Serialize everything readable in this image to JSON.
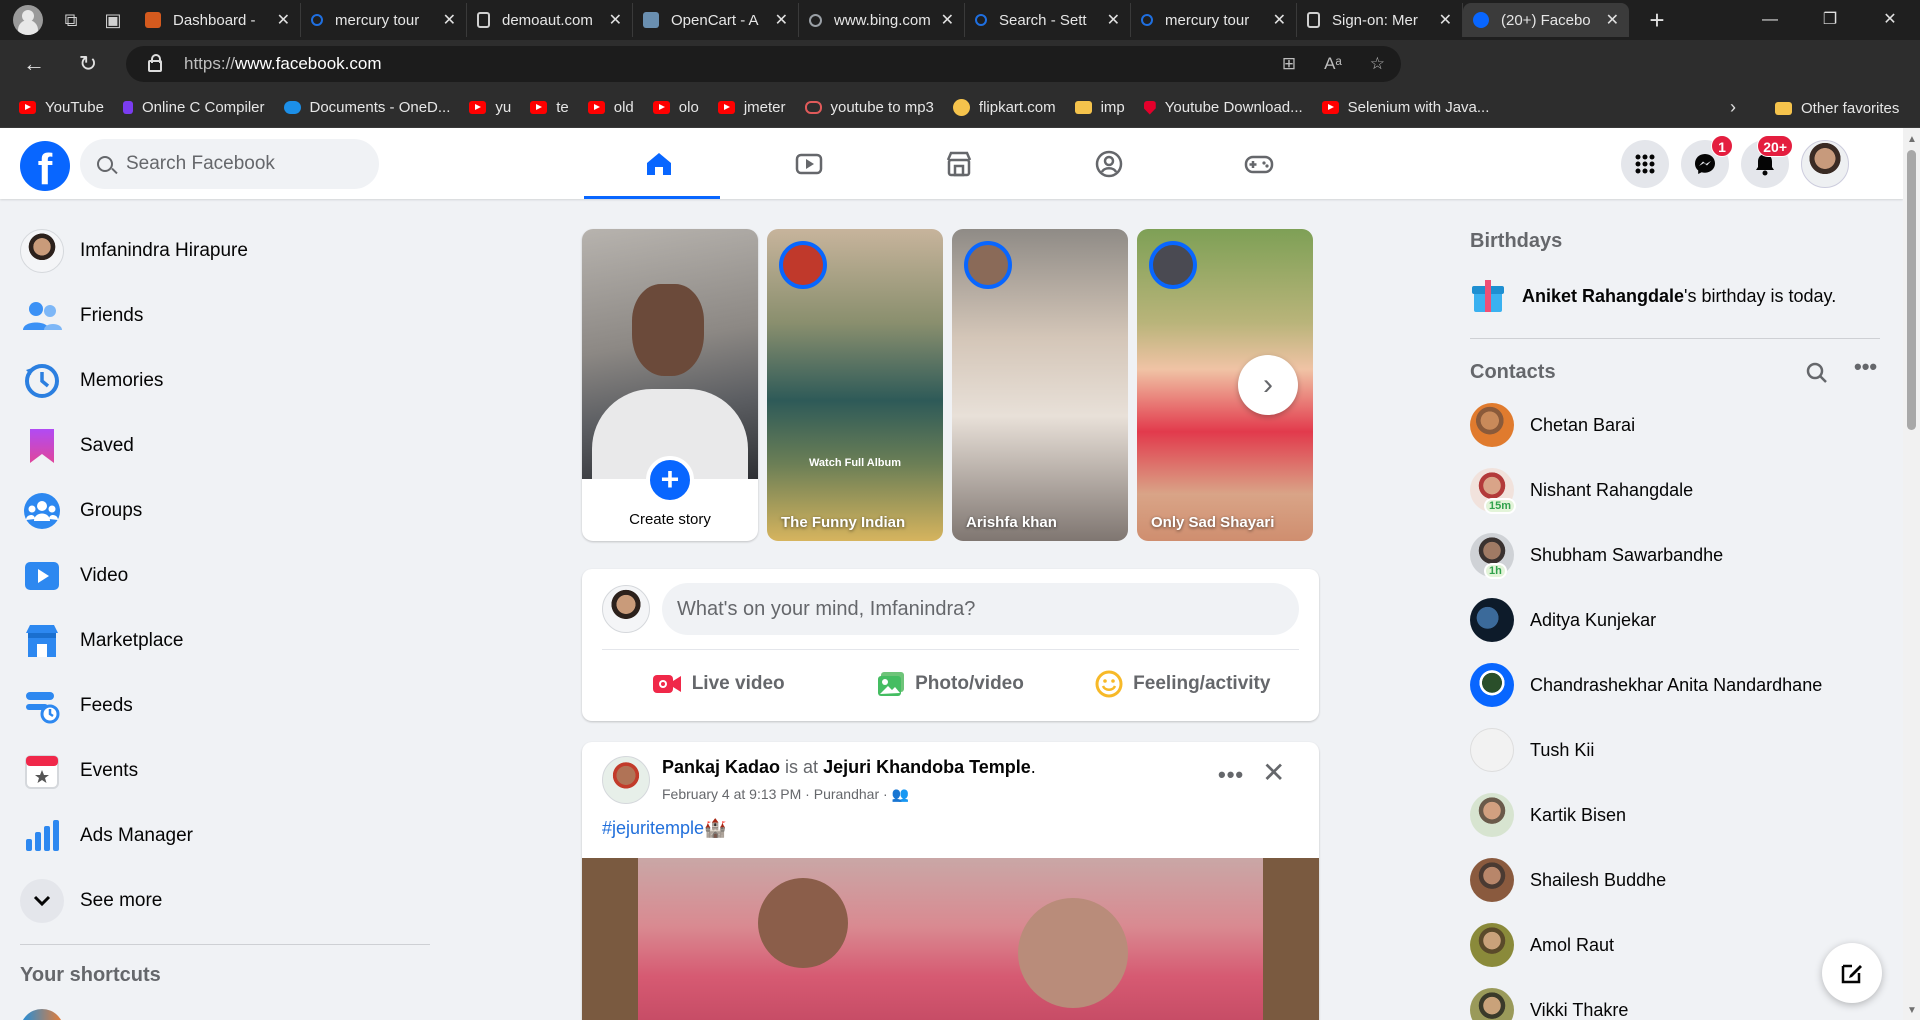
{
  "browser": {
    "tabs": [
      {
        "title": "Dashboard - ",
        "color": "#d45a1e"
      },
      {
        "title": "mercury tour",
        "color": "#1f6fe0"
      },
      {
        "title": "demoaut.com",
        "color": "#9aa0a6"
      },
      {
        "title": "OpenCart - A",
        "color": "#6a8fb0"
      },
      {
        "title": "www.bing.com",
        "color": "#9aa0a6"
      },
      {
        "title": "Search - Sett",
        "color": "#1f6fe0"
      },
      {
        "title": "mercury tour",
        "color": "#1f6fe0"
      },
      {
        "title": "Sign-on: Mer",
        "color": "#9aa0a6"
      },
      {
        "title": "(20+) Facebo",
        "color": "#0866ff"
      }
    ],
    "url_prefix": "https://",
    "url_host": "www.facebook.com",
    "bookmarks": [
      {
        "label": "YouTube",
        "icon": "youtube-icon"
      },
      {
        "label": "Online C Compiler",
        "icon": "compiler-icon"
      },
      {
        "label": "Documents - OneD...",
        "icon": "onedrive-icon"
      },
      {
        "label": "yu",
        "icon": "youtube-icon"
      },
      {
        "label": "te",
        "icon": "youtube-icon"
      },
      {
        "label": "old",
        "icon": "youtube-icon"
      },
      {
        "label": "olo",
        "icon": "youtube-icon"
      },
      {
        "label": "jmeter",
        "icon": "youtube-icon"
      },
      {
        "label": "youtube to mp3",
        "icon": "link-icon"
      },
      {
        "label": "flipkart.com",
        "icon": "flipkart-icon"
      },
      {
        "label": "imp",
        "icon": "folder-icon"
      },
      {
        "label": "Youtube Download...",
        "icon": "download-icon"
      },
      {
        "label": "Selenium with Java...",
        "icon": "youtube-icon"
      }
    ],
    "other_favorites": "Other favorites"
  },
  "fb": {
    "search_placeholder": "Search Facebook",
    "notifications_badge": "20+",
    "messenger_badge": "1",
    "left_nav": [
      {
        "label": "Imfanindra Hirapure",
        "icon": "profile-avatar"
      },
      {
        "label": "Friends",
        "icon": "friends-icon"
      },
      {
        "label": "Memories",
        "icon": "memories-icon"
      },
      {
        "label": "Saved",
        "icon": "saved-icon"
      },
      {
        "label": "Groups",
        "icon": "groups-icon"
      },
      {
        "label": "Video",
        "icon": "video-icon"
      },
      {
        "label": "Marketplace",
        "icon": "marketplace-icon"
      },
      {
        "label": "Feeds",
        "icon": "feeds-icon"
      },
      {
        "label": "Events",
        "icon": "events-icon"
      },
      {
        "label": "Ads Manager",
        "icon": "ads-manager-icon"
      },
      {
        "label": "See more",
        "icon": "chevron-down-icon"
      }
    ],
    "shortcuts_heading": "Your shortcuts",
    "stories": {
      "create_label": "Create story",
      "items": [
        {
          "name": "The Funny Indian",
          "overlay": "Watch Full Album"
        },
        {
          "name": "Arishfa khan",
          "overlay": ""
        },
        {
          "name": "Only Sad Shayari",
          "overlay": ""
        }
      ]
    },
    "composer": {
      "placeholder": "What's on your mind, Imfanindra?",
      "actions": [
        "Live video",
        "Photo/video",
        "Feeling/activity"
      ]
    },
    "post": {
      "author": "Pankaj Kadao",
      "is_at": " is at ",
      "place": "Jejuri Khandoba Temple",
      "period": ".",
      "meta": "February 4 at 9:13 PM · Purandhar · ",
      "hashtag": "#jejuritemple🏰"
    },
    "right": {
      "birthdays_heading": "Birthdays",
      "birthday_name": "Aniket Rahangdale",
      "birthday_text": "'s birthday is today.",
      "contacts_heading": "Contacts",
      "contacts": [
        {
          "name": "Chetan Barai",
          "badge": ""
        },
        {
          "name": "Nishant Rahangdale",
          "badge": "15m"
        },
        {
          "name": "Shubham Sawarbandhe",
          "badge": "1h"
        },
        {
          "name": "Aditya Kunjekar",
          "badge": ""
        },
        {
          "name": "Chandrashekhar Anita Nandardhane",
          "badge": ""
        },
        {
          "name": "Tush Kii",
          "badge": ""
        },
        {
          "name": "Kartik Bisen",
          "badge": ""
        },
        {
          "name": "Shailesh Buddhe",
          "badge": ""
        },
        {
          "name": "Amol Raut",
          "badge": ""
        },
        {
          "name": "Vikki Thakre",
          "badge": ""
        }
      ]
    }
  }
}
